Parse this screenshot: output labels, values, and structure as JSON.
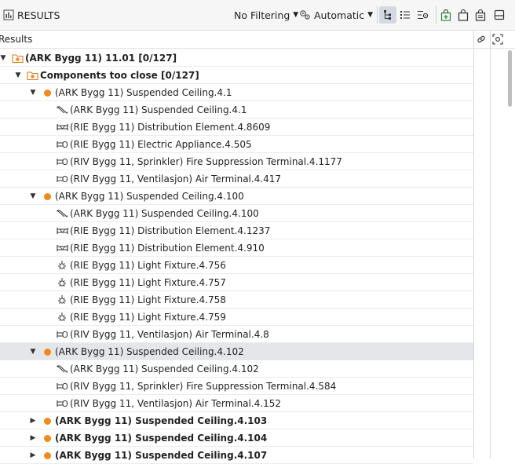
{
  "panel": {
    "title": "RESULTS",
    "filter_label": "No Filtering",
    "mode_label": "Automatic"
  },
  "subheader": {
    "label": "Results"
  },
  "colors": {
    "accent_orange": "#f28a1c",
    "selected_row": "#e4e6ea",
    "toolbar_active": "#d3d8e2"
  },
  "rows": [
    {
      "depth": 0,
      "expander": "expanded",
      "icon": "folder-orange-icon",
      "label": "(ARK Bygg 11) 11.01 [0/127]",
      "bold": true
    },
    {
      "depth": 1,
      "expander": "expanded",
      "icon": "folder-orange-icon",
      "label": "Components too close [0/127]",
      "bold": true
    },
    {
      "depth": 2,
      "expander": "expanded",
      "icon": "orange-dot-icon",
      "label": "(ARK Bygg 11) Suspended Ceiling.4.1",
      "bold": false
    },
    {
      "depth": 3,
      "expander": "none",
      "icon": "ceiling-icon",
      "label": "(ARK Bygg 11) Suspended Ceiling.4.1",
      "bold": false
    },
    {
      "depth": 3,
      "expander": "none",
      "icon": "distribution-icon",
      "label": "(RIE Bygg 11) Distribution Element.4.8609",
      "bold": false
    },
    {
      "depth": 3,
      "expander": "none",
      "icon": "terminal-icon",
      "label": "(RIE Bygg 11) Electric Appliance.4.505",
      "bold": false
    },
    {
      "depth": 3,
      "expander": "none",
      "icon": "terminal-icon",
      "label": "(RIV Bygg 11, Sprinkler) Fire Suppression Terminal.4.1177",
      "bold": false
    },
    {
      "depth": 3,
      "expander": "none",
      "icon": "terminal-icon",
      "label": "(RIV Bygg 11, Ventilasjon) Air Terminal.4.417",
      "bold": false
    },
    {
      "depth": 2,
      "expander": "expanded",
      "icon": "orange-dot-icon",
      "label": "(ARK Bygg 11) Suspended Ceiling.4.100",
      "bold": false
    },
    {
      "depth": 3,
      "expander": "none",
      "icon": "ceiling-icon",
      "label": "(ARK Bygg 11) Suspended Ceiling.4.100",
      "bold": false
    },
    {
      "depth": 3,
      "expander": "none",
      "icon": "distribution-icon",
      "label": "(RIE Bygg 11) Distribution Element.4.1237",
      "bold": false
    },
    {
      "depth": 3,
      "expander": "none",
      "icon": "distribution-icon",
      "label": "(RIE Bygg 11) Distribution Element.4.910",
      "bold": false
    },
    {
      "depth": 3,
      "expander": "none",
      "icon": "light-fixture-icon",
      "label": "(RIE Bygg 11) Light Fixture.4.756",
      "bold": false
    },
    {
      "depth": 3,
      "expander": "none",
      "icon": "light-fixture-icon",
      "label": "(RIE Bygg 11) Light Fixture.4.757",
      "bold": false
    },
    {
      "depth": 3,
      "expander": "none",
      "icon": "light-fixture-icon",
      "label": "(RIE Bygg 11) Light Fixture.4.758",
      "bold": false
    },
    {
      "depth": 3,
      "expander": "none",
      "icon": "light-fixture-icon",
      "label": "(RIE Bygg 11) Light Fixture.4.759",
      "bold": false
    },
    {
      "depth": 3,
      "expander": "none",
      "icon": "terminal-icon",
      "label": "(RIV Bygg 11, Ventilasjon) Air Terminal.4.8",
      "bold": false
    },
    {
      "depth": 2,
      "expander": "expanded",
      "icon": "orange-dot-icon",
      "label": "(ARK Bygg 11) Suspended Ceiling.4.102",
      "bold": false,
      "selected": true
    },
    {
      "depth": 3,
      "expander": "none",
      "icon": "ceiling-icon",
      "label": "(ARK Bygg 11) Suspended Ceiling.4.102",
      "bold": false
    },
    {
      "depth": 3,
      "expander": "none",
      "icon": "terminal-icon",
      "label": "(RIV Bygg 11, Sprinkler) Fire Suppression Terminal.4.584",
      "bold": false
    },
    {
      "depth": 3,
      "expander": "none",
      "icon": "terminal-icon",
      "label": "(RIV Bygg 11, Ventilasjon) Air Terminal.4.152",
      "bold": false
    },
    {
      "depth": 2,
      "expander": "collapsed",
      "icon": "orange-dot-icon",
      "label": "(ARK Bygg 11) Suspended Ceiling.4.103",
      "bold": true
    },
    {
      "depth": 2,
      "expander": "collapsed",
      "icon": "orange-dot-icon",
      "label": "(ARK Bygg 11) Suspended Ceiling.4.104",
      "bold": true
    },
    {
      "depth": 2,
      "expander": "collapsed",
      "icon": "orange-dot-icon",
      "label": "(ARK Bygg 11) Suspended Ceiling.4.107",
      "bold": true
    }
  ]
}
